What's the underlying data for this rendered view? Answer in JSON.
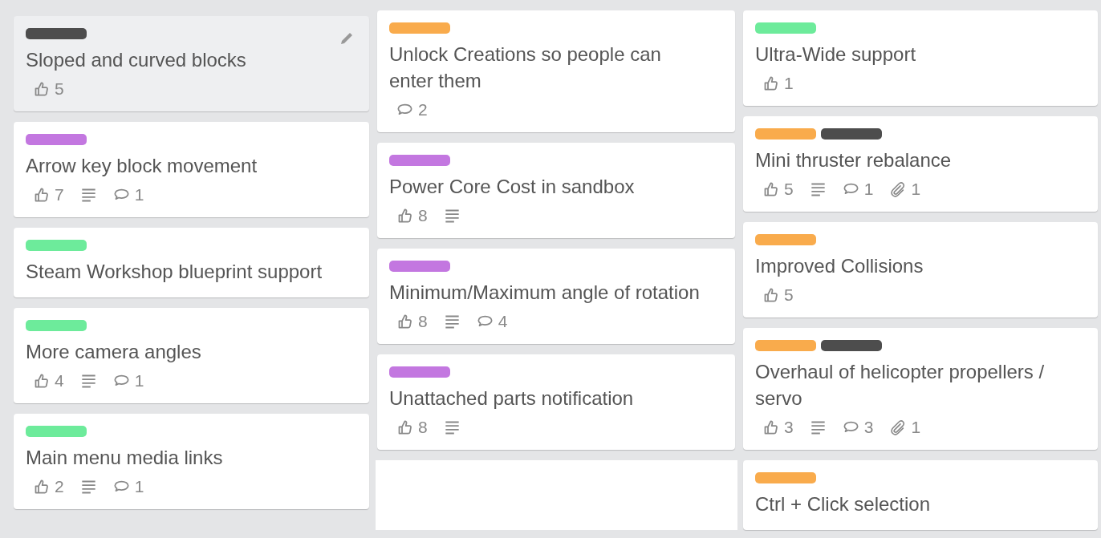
{
  "columns": [
    {
      "cards": [
        {
          "labels": [
            {
              "color": "#4d4d4d"
            }
          ],
          "title": "Sloped and curved blocks",
          "hovered": true,
          "badges": [
            {
              "kind": "votes",
              "count": "5"
            }
          ]
        },
        {
          "labels": [
            {
              "color": "#c377e0"
            }
          ],
          "title": "Arrow key block movement",
          "hovered": false,
          "badges": [
            {
              "kind": "votes",
              "count": "7"
            },
            {
              "kind": "description"
            },
            {
              "kind": "comments",
              "count": "1"
            }
          ]
        },
        {
          "labels": [
            {
              "color": "#6deb9b"
            }
          ],
          "title": "Steam Workshop blueprint support",
          "hovered": false
        },
        {
          "labels": [
            {
              "color": "#6deb9b"
            }
          ],
          "title": "More camera angles",
          "hovered": false,
          "badges": [
            {
              "kind": "votes",
              "count": "4"
            },
            {
              "kind": "description"
            },
            {
              "kind": "comments",
              "count": "1"
            }
          ]
        },
        {
          "labels": [
            {
              "color": "#6deb9b"
            }
          ],
          "title": "Main menu media links",
          "hovered": false,
          "badges": [
            {
              "kind": "votes",
              "count": "2"
            },
            {
              "kind": "description"
            },
            {
              "kind": "comments",
              "count": "1"
            }
          ]
        }
      ]
    },
    {
      "cards": [
        {
          "labels": [
            {
              "color": "#f9ab4c"
            }
          ],
          "title": "Unlock Creations so people can enter them",
          "hovered": false,
          "badges": [
            {
              "kind": "comments",
              "count": "2"
            }
          ]
        },
        {
          "labels": [
            {
              "color": "#c377e0"
            }
          ],
          "title": "Power Core Cost in sandbox",
          "hovered": false,
          "badges": [
            {
              "kind": "votes",
              "count": "8"
            },
            {
              "kind": "description"
            }
          ]
        },
        {
          "labels": [
            {
              "color": "#c377e0"
            }
          ],
          "title": "Minimum/Maximum angle of rotation",
          "hovered": false,
          "badges": [
            {
              "kind": "votes",
              "count": "8"
            },
            {
              "kind": "description"
            },
            {
              "kind": "comments",
              "count": "4"
            }
          ]
        },
        {
          "labels": [
            {
              "color": "#c377e0"
            }
          ],
          "title": "Unattached parts notification",
          "hovered": false,
          "badges": [
            {
              "kind": "votes",
              "count": "8"
            },
            {
              "kind": "description"
            }
          ]
        }
      ],
      "composer": true
    },
    {
      "cards": [
        {
          "labels": [
            {
              "color": "#6deb9b"
            }
          ],
          "title": "Ultra-Wide support",
          "hovered": false,
          "badges": [
            {
              "kind": "votes",
              "count": "1"
            }
          ]
        },
        {
          "labels": [
            {
              "color": "#f9ab4c"
            },
            {
              "color": "#4d4d4d"
            }
          ],
          "title": "Mini thruster rebalance",
          "hovered": false,
          "badges": [
            {
              "kind": "votes",
              "count": "5"
            },
            {
              "kind": "description"
            },
            {
              "kind": "comments",
              "count": "1"
            },
            {
              "kind": "attachments",
              "count": "1"
            }
          ]
        },
        {
          "labels": [
            {
              "color": "#f9ab4c"
            }
          ],
          "title": "Improved Collisions",
          "hovered": false,
          "badges": [
            {
              "kind": "votes",
              "count": "5"
            }
          ]
        },
        {
          "labels": [
            {
              "color": "#f9ab4c"
            },
            {
              "color": "#4d4d4d"
            }
          ],
          "title": "Overhaul of helicopter propellers / servo",
          "hovered": false,
          "badges": [
            {
              "kind": "votes",
              "count": "3"
            },
            {
              "kind": "description"
            },
            {
              "kind": "comments",
              "count": "3"
            },
            {
              "kind": "attachments",
              "count": "1"
            }
          ]
        },
        {
          "labels": [
            {
              "color": "#f9ab4c"
            }
          ],
          "title": "Ctrl + Click selection",
          "hovered": false
        }
      ]
    }
  ]
}
